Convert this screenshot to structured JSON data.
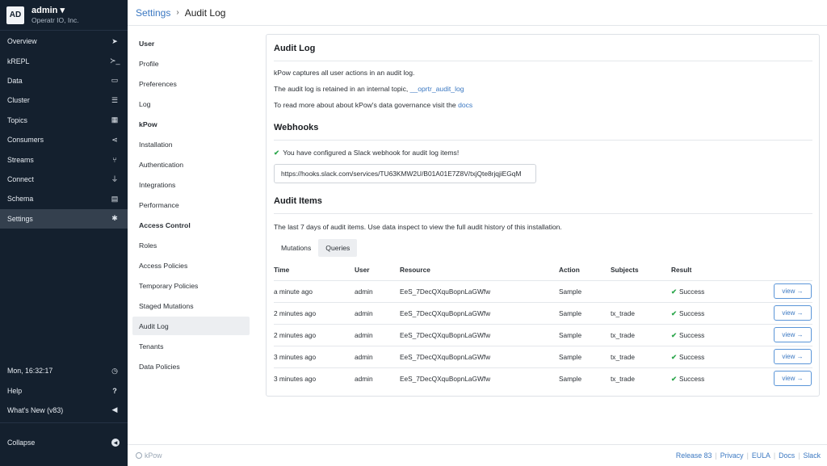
{
  "org": {
    "initials": "AD",
    "user": "admin",
    "user_caret": "▾",
    "name": "Operatr IO, Inc."
  },
  "nav": [
    {
      "label": "Overview",
      "icon": "send-icon",
      "glyph": "➤"
    },
    {
      "label": "kREPL",
      "icon": "terminal-icon",
      "glyph": "≻_"
    },
    {
      "label": "Data",
      "icon": "folder-icon",
      "glyph": "▭"
    },
    {
      "label": "Cluster",
      "icon": "server-icon",
      "glyph": "☰"
    },
    {
      "label": "Topics",
      "icon": "table-icon",
      "glyph": "▦"
    },
    {
      "label": "Consumers",
      "icon": "share-icon",
      "glyph": "⋖"
    },
    {
      "label": "Streams",
      "icon": "branch-icon",
      "glyph": "⑂"
    },
    {
      "label": "Connect",
      "icon": "plug-icon",
      "glyph": "⏚"
    },
    {
      "label": "Schema",
      "icon": "file-icon",
      "glyph": "▤"
    },
    {
      "label": "Settings",
      "icon": "gear-icon",
      "glyph": "✱"
    }
  ],
  "nav_bottom": {
    "clock": {
      "label": "Mon, 16:32:17",
      "glyph": "◷"
    },
    "help": {
      "label": "Help",
      "glyph": "?"
    },
    "whats_new": {
      "label": "What's New (v83)",
      "glyph": "◀"
    },
    "collapse": {
      "label": "Collapse",
      "glyph": "◀"
    }
  },
  "breadcrumb": {
    "parent": "Settings",
    "separator": "›",
    "current": "Audit Log"
  },
  "submenu": [
    {
      "label": "User",
      "head": true
    },
    {
      "label": "Profile"
    },
    {
      "label": "Preferences"
    },
    {
      "label": "Log"
    },
    {
      "label": "kPow",
      "head": true
    },
    {
      "label": "Installation"
    },
    {
      "label": "Authentication"
    },
    {
      "label": "Integrations"
    },
    {
      "label": "Performance"
    },
    {
      "label": "Access Control",
      "head": true
    },
    {
      "label": "Roles"
    },
    {
      "label": "Access Policies"
    },
    {
      "label": "Temporary Policies"
    },
    {
      "label": "Staged Mutations"
    },
    {
      "label": "Audit Log",
      "active": true
    },
    {
      "label": "Tenants"
    },
    {
      "label": "Data Policies"
    }
  ],
  "audit": {
    "title": "Audit Log",
    "line1": "kPow captures all user actions in an audit log.",
    "line2_prefix": "The audit log is retained in an internal topic, ",
    "line2_link": "__oprtr_audit_log",
    "line3_prefix": "To read more about about kPow's data governance visit the ",
    "line3_link": "docs"
  },
  "webhooks": {
    "title": "Webhooks",
    "status_check": "✔",
    "status": "You have configured a Slack webhook for audit log items!",
    "url": "https://hooks.slack.com/services/TU63KMW2U/B01A01E7Z8V/txjQte8rjqjiEGqM"
  },
  "items": {
    "title": "Audit Items",
    "description": "The last 7 days of audit items. Use data inspect to view the full audit history of this installation.",
    "tabs": [
      "Mutations",
      "Queries"
    ],
    "active_tab": 1,
    "columns": [
      "Time",
      "User",
      "Resource",
      "Action",
      "Subjects",
      "Result"
    ],
    "rows": [
      {
        "time": "a minute ago",
        "user": "admin",
        "resource": "EeS_7DecQXquBopnLaGWfw",
        "action": "Sample",
        "subjects": "",
        "result": "Success",
        "button": "view →"
      },
      {
        "time": "2 minutes ago",
        "user": "admin",
        "resource": "EeS_7DecQXquBopnLaGWfw",
        "action": "Sample",
        "subjects": "tx_trade",
        "result": "Success",
        "button": "view →"
      },
      {
        "time": "2 minutes ago",
        "user": "admin",
        "resource": "EeS_7DecQXquBopnLaGWfw",
        "action": "Sample",
        "subjects": "tx_trade",
        "result": "Success",
        "button": "view →"
      },
      {
        "time": "3 minutes ago",
        "user": "admin",
        "resource": "EeS_7DecQXquBopnLaGWfw",
        "action": "Sample",
        "subjects": "tx_trade",
        "result": "Success",
        "button": "view →"
      },
      {
        "time": "3 minutes ago",
        "user": "admin",
        "resource": "EeS_7DecQXquBopnLaGWfw",
        "action": "Sample",
        "subjects": "tx_trade",
        "result": "Success",
        "button": "view →"
      }
    ],
    "result_check": "✔"
  },
  "footer": {
    "brand": "kPow",
    "links": [
      "Release 83",
      "Privacy",
      "EULA",
      "Docs",
      "Slack"
    ],
    "separator": "|"
  },
  "colors": {
    "sidebar": "#14202e",
    "accent": "#3b78c2",
    "success": "#2fa84f"
  }
}
